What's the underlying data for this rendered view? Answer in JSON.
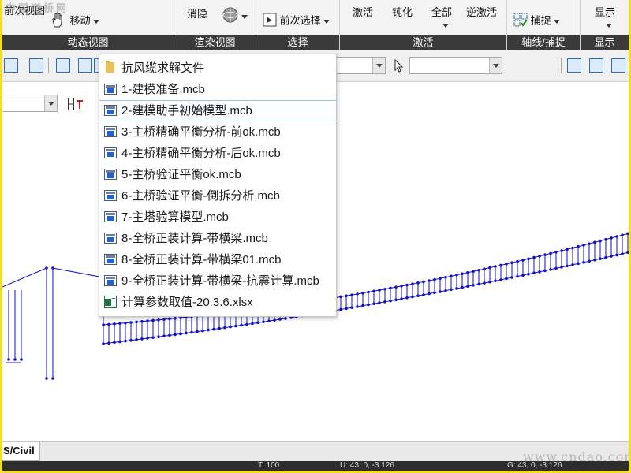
{
  "ribbon": {
    "groups": [
      {
        "label": "动态视图",
        "buttons": [
          "前次视图",
          "移动"
        ]
      },
      {
        "label": "渲染视图",
        "buttons": [
          "消隐"
        ]
      },
      {
        "label": "选择",
        "buttons": [
          "前次选择"
        ]
      },
      {
        "label": "激活",
        "buttons": [
          "激活",
          "钝化",
          "全部",
          "逆激活"
        ]
      },
      {
        "label": "轴线/捕捉",
        "buttons": [
          "捕捉"
        ]
      },
      {
        "label": "显示",
        "buttons": [
          "显示"
        ]
      }
    ]
  },
  "file_menu": {
    "items": [
      {
        "label": "抗风缆求解文件",
        "icon": "folder-icon"
      },
      {
        "label": "1-建模准备.mcb",
        "icon": "mcb-file-icon"
      },
      {
        "label": "2-建模助手初始模型.mcb",
        "icon": "mcb-file-icon",
        "highlighted": true
      },
      {
        "label": "3-主桥精确平衡分析-前ok.mcb",
        "icon": "mcb-file-icon"
      },
      {
        "label": "4-主桥精确平衡分析-后ok.mcb",
        "icon": "mcb-file-icon"
      },
      {
        "label": "5-主桥验证平衡ok.mcb",
        "icon": "mcb-file-icon"
      },
      {
        "label": "6-主桥验证平衡-倒拆分析.mcb",
        "icon": "mcb-file-icon"
      },
      {
        "label": "7-主塔验算模型.mcb",
        "icon": "mcb-file-icon"
      },
      {
        "label": "8-全桥正装计算-带横梁.mcb",
        "icon": "mcb-file-icon"
      },
      {
        "label": "8-全桥正装计算-带横梁01.mcb",
        "icon": "mcb-file-icon"
      },
      {
        "label": "9-全桥正装计算-带横梁-抗震计算.mcb",
        "icon": "mcb-file-icon"
      },
      {
        "label": "计算参数取值-20.3.6.xlsx",
        "icon": "excel-file-icon"
      }
    ]
  },
  "tabs": {
    "active": "S/Civil"
  },
  "status": {
    "fields": [
      "T: 100",
      "U: 43, 0, -3.126",
      "G: 43, 0, -3.126"
    ]
  },
  "watermarks": {
    "top_left": "中国道桥网",
    "bottom_right": "www.cndao.com"
  },
  "colors": {
    "model_line": "#1010c8",
    "ribbon_label_bg": "#3a3a3a",
    "frame_border": "#f2dd2a"
  }
}
